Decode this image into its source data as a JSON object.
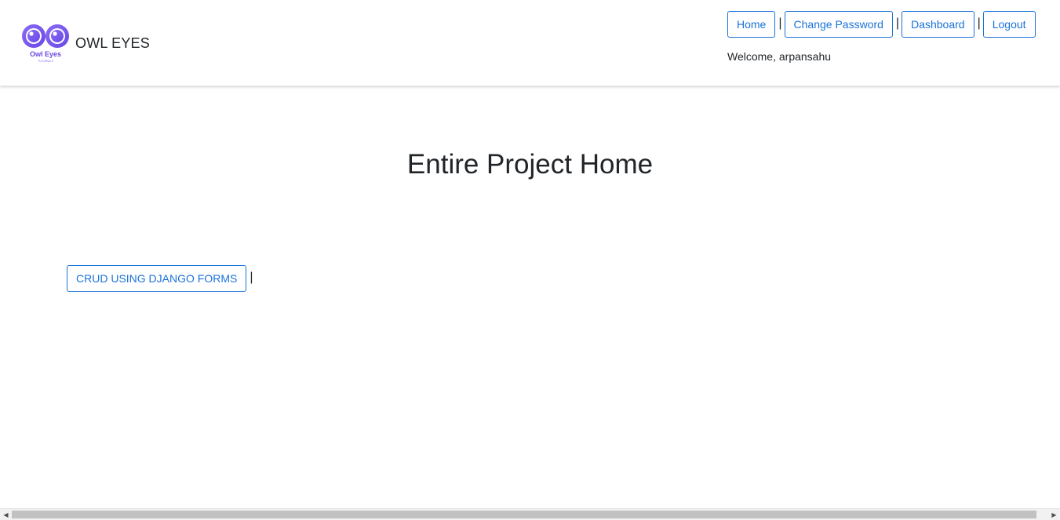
{
  "header": {
    "brand_text": "OWL EYES",
    "logo_text": "Owl Eyes",
    "logo_subtext": "TUTORIALS",
    "nav": [
      {
        "label": "Home"
      },
      {
        "label": "Change Password"
      },
      {
        "label": "Dashboard"
      },
      {
        "label": "Logout"
      }
    ],
    "separator": "|",
    "welcome": "Welcome, arpansahu"
  },
  "main": {
    "title": "Entire Project Home",
    "links": [
      {
        "label": "CRUD USING DJANGO FORMS"
      }
    ],
    "separator": "|"
  },
  "scrollbar": {
    "left_arrow": "◀",
    "right_arrow": "▶"
  },
  "colors": {
    "accent": "#1a73d9",
    "logo_purple": "#7b5cf0",
    "text": "#212529"
  }
}
